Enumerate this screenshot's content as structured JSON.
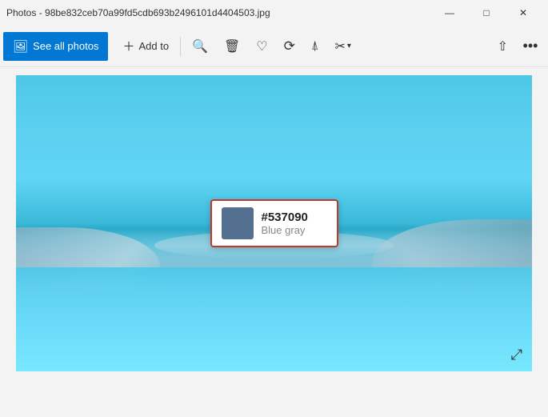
{
  "titlebar": {
    "title": "Photos - 98be832ceb70a99fd5cdb693b2496101d4404503.jpg",
    "minimize_label": "—",
    "maximize_label": "□",
    "close_label": "✕"
  },
  "toolbar": {
    "see_all_photos_label": "See all photos",
    "add_to_label": "Add to",
    "zoom_icon": "🔍",
    "delete_icon": "🗑",
    "favorite_icon": "♡",
    "rotate_icon": "↻",
    "crop_icon": "⊡",
    "edit_icon": "✂",
    "share_icon": "⬆",
    "more_icon": "•••"
  },
  "image": {
    "alt": "Landscape photo with blue sky and water"
  },
  "color_tooltip": {
    "hex": "#537090",
    "name": "Blue gray",
    "swatch_color": "#537090"
  },
  "expand": {
    "icon": "⤢"
  }
}
